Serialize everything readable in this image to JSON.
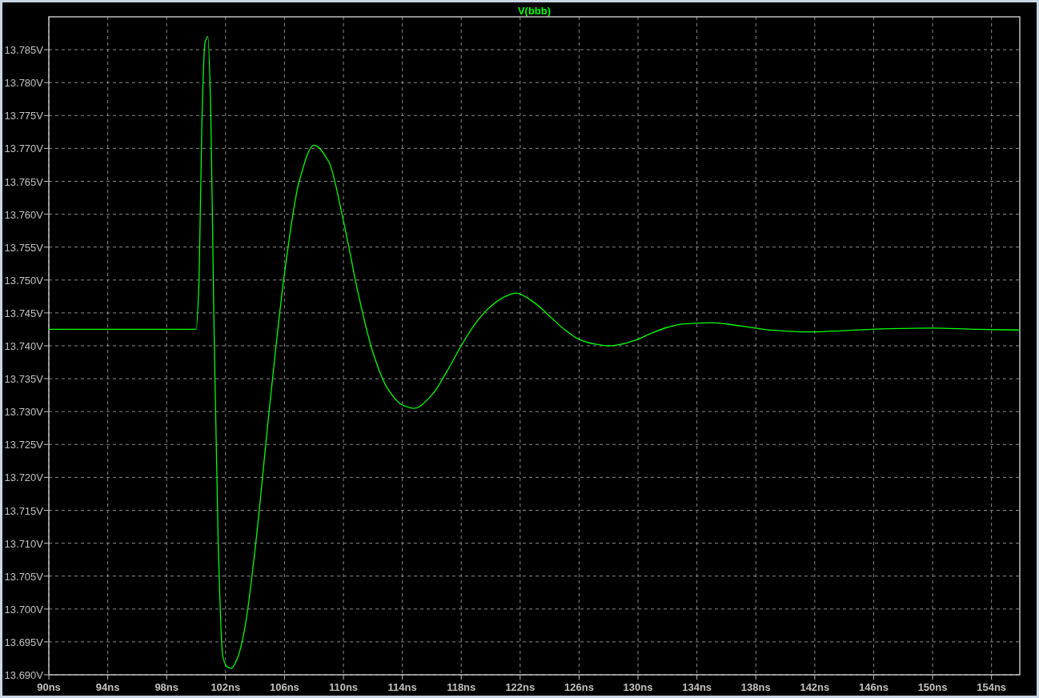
{
  "plot": {
    "chart_data": {
      "type": "line",
      "grid": true,
      "xlim": [
        90,
        155.92
      ],
      "ylim": [
        13.69,
        13.79
      ],
      "xticks": [
        {
          "value": 90,
          "label": "90ns"
        },
        {
          "value": 94,
          "label": "94ns"
        },
        {
          "value": 98,
          "label": "98ns"
        },
        {
          "value": 102,
          "label": "102ns"
        },
        {
          "value": 106,
          "label": "106ns"
        },
        {
          "value": 110,
          "label": "110ns"
        },
        {
          "value": 114,
          "label": "114ns"
        },
        {
          "value": 118,
          "label": "118ns"
        },
        {
          "value": 122,
          "label": "122ns"
        },
        {
          "value": 126,
          "label": "126ns"
        },
        {
          "value": 130,
          "label": "130ns"
        },
        {
          "value": 134,
          "label": "134ns"
        },
        {
          "value": 138,
          "label": "138ns"
        },
        {
          "value": 142,
          "label": "142ns"
        },
        {
          "value": 146,
          "label": "146ns"
        },
        {
          "value": 150,
          "label": "150ns"
        },
        {
          "value": 154,
          "label": "154ns"
        }
      ],
      "yticks": [
        {
          "value": 13.69,
          "label": "13.690V"
        },
        {
          "value": 13.695,
          "label": "13.695V"
        },
        {
          "value": 13.7,
          "label": "13.700V"
        },
        {
          "value": 13.705,
          "label": "13.705V"
        },
        {
          "value": 13.71,
          "label": "13.710V"
        },
        {
          "value": 13.715,
          "label": "13.715V"
        },
        {
          "value": 13.72,
          "label": "13.720V"
        },
        {
          "value": 13.725,
          "label": "13.725V"
        },
        {
          "value": 13.73,
          "label": "13.730V"
        },
        {
          "value": 13.735,
          "label": "13.735V"
        },
        {
          "value": 13.74,
          "label": "13.740V"
        },
        {
          "value": 13.745,
          "label": "13.745V"
        },
        {
          "value": 13.75,
          "label": "13.750V"
        },
        {
          "value": 13.755,
          "label": "13.755V"
        },
        {
          "value": 13.76,
          "label": "13.760V"
        },
        {
          "value": 13.765,
          "label": "13.765V"
        },
        {
          "value": 13.77,
          "label": "13.770V"
        },
        {
          "value": 13.775,
          "label": "13.775V"
        },
        {
          "value": 13.78,
          "label": "13.780V"
        },
        {
          "value": 13.785,
          "label": "13.785V"
        }
      ],
      "x": [
        90,
        100,
        100.2,
        100.4,
        100.6,
        100.8,
        101,
        101.2,
        101.5,
        101.8,
        102.1,
        102.4,
        102.8,
        103.3,
        104,
        105,
        106,
        107,
        108,
        109,
        110,
        111,
        112,
        113,
        114,
        114.8,
        116,
        117,
        118,
        119,
        120,
        121,
        121.7,
        123,
        124,
        125,
        126,
        127,
        128.1,
        129,
        130,
        131,
        132,
        133,
        135,
        137,
        139,
        141.6,
        144,
        147,
        150,
        153,
        155.92
      ],
      "series": [
        {
          "name": "V(bbb)",
          "color": "#00ff00",
          "values": [
            13.7425,
            13.7425,
            13.75,
            13.775,
            13.786,
            13.787,
            13.775,
            13.745,
            13.71,
            13.693,
            13.6912,
            13.691,
            13.6925,
            13.697,
            13.709,
            13.731,
            13.751,
            13.765,
            13.7705,
            13.768,
            13.759,
            13.748,
            13.739,
            13.7335,
            13.731,
            13.7305,
            13.7325,
            13.736,
            13.74,
            13.7435,
            13.746,
            13.7475,
            13.748,
            13.7465,
            13.7445,
            13.7425,
            13.741,
            13.7403,
            13.74,
            13.7403,
            13.741,
            13.742,
            13.7428,
            13.7433,
            13.7435,
            13.743,
            13.7424,
            13.7421,
            13.7423,
            13.7426,
            13.7427,
            13.7425,
            13.7424
          ]
        }
      ]
    }
  }
}
